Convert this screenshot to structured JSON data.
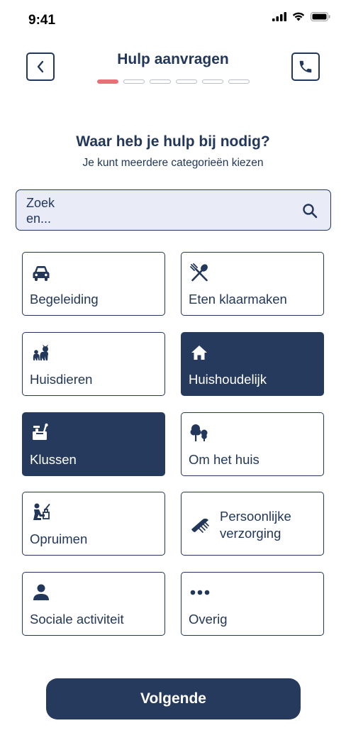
{
  "status_bar": {
    "time": "9:41"
  },
  "header": {
    "title": "Hulp aanvragen"
  },
  "stepper": {
    "total_steps": 6,
    "current_step": 1
  },
  "question": {
    "title": "Waar heb je hulp bij nodig?",
    "subtitle": "Je kunt meerdere categorieën kiezen"
  },
  "search": {
    "placeholder": "Zoek en..."
  },
  "categories": [
    {
      "label": "Begeleiding",
      "icon": "car-icon",
      "selected": false
    },
    {
      "label": "Eten klaarmaken",
      "icon": "fork-spoon-icon",
      "selected": false
    },
    {
      "label": "Huisdieren",
      "icon": "pets-icon",
      "selected": false
    },
    {
      "label": "Huishoudelijk",
      "icon": "home-icon",
      "selected": true
    },
    {
      "label": "Klussen",
      "icon": "toolbox-icon",
      "selected": true
    },
    {
      "label": "Om het huis",
      "icon": "trees-icon",
      "selected": false
    },
    {
      "label": "Opruimen",
      "icon": "tidy-up-icon",
      "selected": false
    },
    {
      "label": "Persoonlijke verzorging",
      "icon": "comb-icon",
      "selected": false
    },
    {
      "label": "Sociale activiteit",
      "icon": "person-icon",
      "selected": false
    },
    {
      "label": "Overig",
      "icon": "more-dots-icon",
      "selected": false
    }
  ],
  "footer": {
    "next_label": "Volgende"
  },
  "colors": {
    "primary": "#263a5e",
    "accent": "#ea7078",
    "search_bg": "#e9ebf6"
  }
}
